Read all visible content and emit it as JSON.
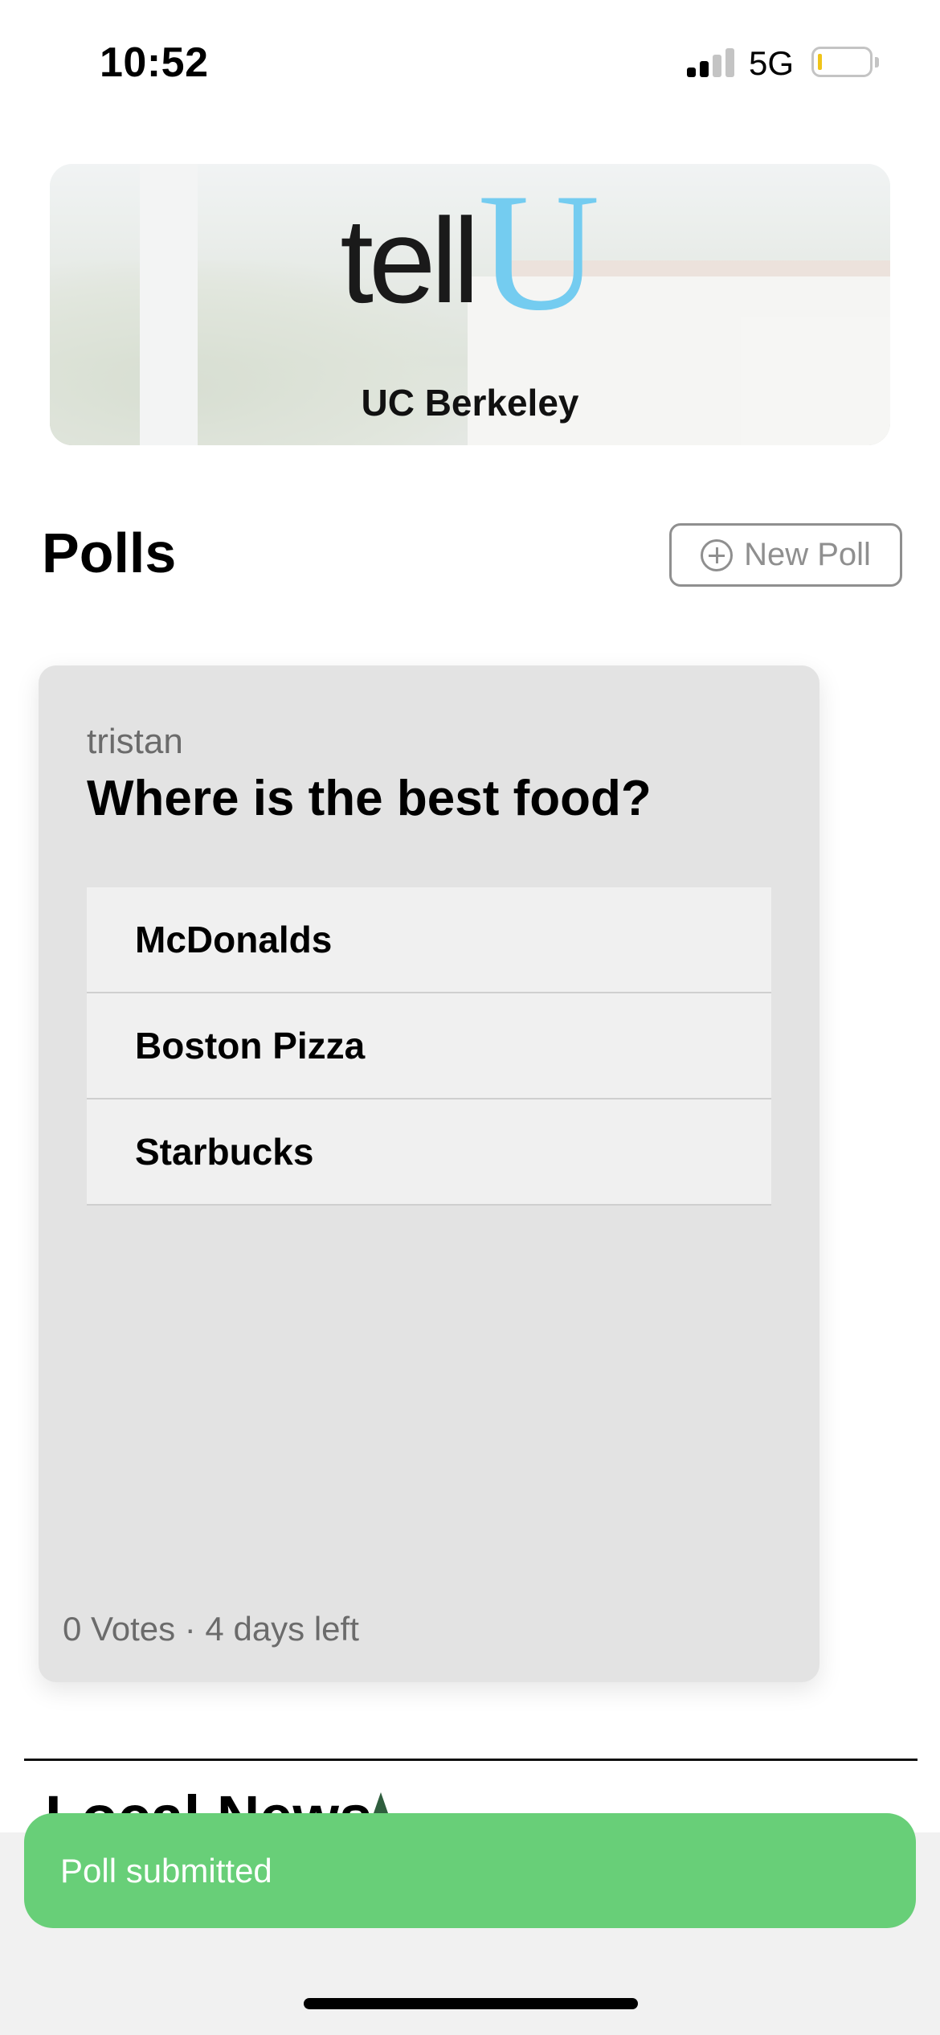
{
  "status_bar": {
    "time": "10:52",
    "network": "5G",
    "signal_bars_active": 2,
    "signal_bars_total": 4,
    "battery_level_percent": 8,
    "battery_color": "#f0c419"
  },
  "banner": {
    "logo_part1": "tell",
    "logo_part2": "U",
    "logo_accent_color": "#74ccf0",
    "school": "UC Berkeley"
  },
  "polls": {
    "title": "Polls",
    "new_poll_label": "New Poll",
    "card": {
      "author": "tristan",
      "question": "Where is the best food?",
      "options": [
        "McDonalds",
        "Boston Pizza",
        "Starbucks"
      ],
      "footer": "0 Votes · 4 days left"
    }
  },
  "local_news": {
    "title": "Local News"
  },
  "toast": {
    "message": "Poll submitted",
    "color": "#68cf78"
  }
}
